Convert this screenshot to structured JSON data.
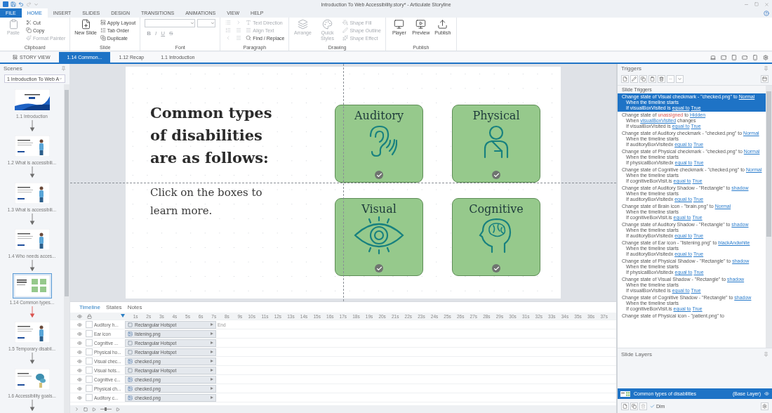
{
  "window": {
    "title": "Introduction To Web Accessibility.story* - Articulate Storyline"
  },
  "ribbon_tabs": [
    {
      "label": "FILE",
      "kind": "file",
      "selected": false
    },
    {
      "label": "HOME",
      "kind": "tab",
      "selected": true
    },
    {
      "label": "INSERT",
      "kind": "tab",
      "selected": false
    },
    {
      "label": "SLIDES",
      "kind": "tab",
      "selected": false
    },
    {
      "label": "DESIGN",
      "kind": "tab",
      "selected": false
    },
    {
      "label": "TRANSITIONS",
      "kind": "tab",
      "selected": false
    },
    {
      "label": "ANIMATIONS",
      "kind": "tab",
      "selected": false
    },
    {
      "label": "VIEW",
      "kind": "tab",
      "selected": false
    },
    {
      "label": "HELP",
      "kind": "tab",
      "selected": false
    }
  ],
  "ribbon_groups": [
    {
      "label": "Clipboard",
      "kind": "standard",
      "items": [
        {
          "label": "Paste",
          "kind": "large",
          "disabled": true
        },
        {
          "label": "Cut",
          "kind": "small",
          "disabled": false
        },
        {
          "label": "Copy",
          "kind": "small",
          "disabled": false
        },
        {
          "label": "Format Painter",
          "kind": "small",
          "disabled": true
        }
      ]
    },
    {
      "label": "Slide",
      "kind": "standard",
      "items": [
        {
          "label": "New Slide",
          "kind": "large",
          "disabled": false
        },
        {
          "label": "Apply Layout",
          "kind": "small",
          "disabled": false
        },
        {
          "label": "Tab Order",
          "kind": "small",
          "disabled": false
        },
        {
          "label": "Duplicate",
          "kind": "small",
          "disabled": false
        }
      ]
    },
    {
      "label": "Font",
      "kind": "font",
      "disabled": true,
      "format_buttons": [
        "B",
        "I",
        "U",
        "S"
      ]
    },
    {
      "label": "Paragraph",
      "kind": "standard",
      "items": [
        {
          "kind": "icon",
          "disabled": true
        },
        {
          "kind": "icon",
          "disabled": true
        },
        {
          "kind": "icon",
          "disabled": true
        },
        {
          "kind": "icon",
          "disabled": true
        },
        {
          "kind": "icon",
          "disabled": true
        },
        {
          "kind": "icon",
          "disabled": true
        },
        {
          "label": "Text Direction",
          "kind": "small",
          "disabled": true
        },
        {
          "label": "Align Text",
          "kind": "small",
          "disabled": true
        },
        {
          "label": "Find / Replace",
          "kind": "small",
          "disabled": false
        }
      ]
    },
    {
      "label": "Drawing",
      "kind": "standard",
      "items": [
        {
          "label": "Arrange",
          "kind": "large",
          "disabled": true
        },
        {
          "label": "Quick Styles",
          "kind": "large",
          "disabled": true
        },
        {
          "label": "Shape Fill",
          "kind": "small",
          "disabled": true
        },
        {
          "label": "Shape Outline",
          "kind": "small",
          "disabled": true
        },
        {
          "label": "Shape Effect",
          "kind": "small",
          "disabled": true
        }
      ]
    },
    {
      "label": "Publish",
      "kind": "standard",
      "items": [
        {
          "label": "Player",
          "kind": "large",
          "disabled": false
        },
        {
          "label": "Preview",
          "kind": "large",
          "disabled": false
        },
        {
          "label": "Publish",
          "kind": "large",
          "disabled": false
        }
      ]
    }
  ],
  "doc_tabs": [
    {
      "label": "STORY VIEW",
      "kind": "story",
      "selected": false
    },
    {
      "label": "1.14 Common...",
      "kind": "slide",
      "selected": true
    },
    {
      "label": "1.12 Recap",
      "kind": "slide",
      "selected": false
    },
    {
      "label": "1.1 Introduction",
      "kind": "slide",
      "selected": false
    }
  ],
  "scenes": {
    "title": "Scenes",
    "dropdown": "1 Introduction To Web A",
    "slides": [
      {
        "label": "1.1 Introduction",
        "kind": "waves",
        "selected": false,
        "color": "#6d6d6d"
      },
      {
        "label": "1.2 What is accessibili...",
        "kind": "figure",
        "selected": false,
        "color": "#6d6d6d"
      },
      {
        "label": "1.3 What is accessibili...",
        "kind": "figure",
        "selected": false,
        "color": "#6d6d6d"
      },
      {
        "label": "1.4 Who needs acces...",
        "kind": "figure",
        "selected": false,
        "color": "#6d6d6d"
      },
      {
        "label": "1.14 Common types...",
        "kind": "grid",
        "selected": true,
        "color": "#d9534f"
      },
      {
        "label": "1.5 Temporary disabil...",
        "kind": "figure",
        "selected": false,
        "color": "#6d6d6d"
      },
      {
        "label": "1.6 Accessibility goals...",
        "kind": "plant",
        "selected": false,
        "color": "#6d6d6d"
      }
    ]
  },
  "slide": {
    "heading": "Common types of disabilities are as follows:",
    "body": "Click on the boxes to learn more.",
    "cards": [
      {
        "title": "Auditory",
        "kind": "ear",
        "checked": true
      },
      {
        "title": "Physical",
        "kind": "person",
        "checked": true
      },
      {
        "title": "Visual",
        "kind": "eye",
        "checked": true
      },
      {
        "title": "Cognitive",
        "kind": "brain",
        "checked": true
      }
    ]
  },
  "timeline": {
    "tabs": [
      {
        "label": "Timeline",
        "selected": true
      },
      {
        "label": "States",
        "selected": false
      },
      {
        "label": "Notes",
        "selected": false
      }
    ],
    "ticks": [
      "1s",
      "2s",
      "3s",
      "4s",
      "5s",
      "6s",
      "7s",
      "8s",
      "9s",
      "10s",
      "11s",
      "12s",
      "13s",
      "14s",
      "15s",
      "16s",
      "17s",
      "18s",
      "19s",
      "20s",
      "21s",
      "22s",
      "23s",
      "24s",
      "25s",
      "26s",
      "27s",
      "28s",
      "29s",
      "30s",
      "31s",
      "32s",
      "33s",
      "34s",
      "35s",
      "36s",
      "37s"
    ],
    "end_label": "End",
    "rows": [
      {
        "name": "Auditory h...",
        "object": "Rectangular Hotspot",
        "kind": "hotspot",
        "visible": true,
        "locked": false
      },
      {
        "name": "Ear icon",
        "object": "listening.png",
        "kind": "image",
        "visible": true,
        "locked": false
      },
      {
        "name": "Cognitive ...",
        "object": "Rectangular Hotspot",
        "kind": "hotspot",
        "visible": true,
        "locked": false
      },
      {
        "name": "Physical ho...",
        "object": "Rectangular Hotspot",
        "kind": "hotspot",
        "visible": true,
        "locked": false
      },
      {
        "name": "Visual chec...",
        "object": "checked.png",
        "kind": "image",
        "visible": true,
        "locked": false
      },
      {
        "name": "Visual hots...",
        "object": "Rectangular Hotspot",
        "kind": "hotspot",
        "visible": true,
        "locked": false
      },
      {
        "name": "Cognitive c...",
        "object": "checked.png",
        "kind": "image",
        "visible": true,
        "locked": false
      },
      {
        "name": "Physical ch...",
        "object": "checked.png",
        "kind": "image",
        "visible": true,
        "locked": false
      },
      {
        "name": "Auditory c...",
        "object": "checked.png",
        "kind": "image",
        "visible": true,
        "locked": false
      }
    ],
    "zoom": {
      "level": 0.35
    }
  },
  "triggers": {
    "title": "Triggers",
    "section": "Slide Triggers",
    "items": [
      {
        "selected": true,
        "lines": [
          [
            {
              "text": "Change state of Visual checkmark - \"checked.png\" to",
              "kind": "text"
            },
            {
              "text": "Normal",
              "kind": "link"
            }
          ],
          [
            {
              "text": "When the timeline starts",
              "kind": "text"
            }
          ],
          [
            {
              "text": "If visualBoxVisited is",
              "kind": "text"
            },
            {
              "text": "equal to",
              "kind": "link"
            },
            {
              "text": "True",
              "kind": "link"
            }
          ]
        ]
      },
      {
        "selected": false,
        "lines": [
          [
            {
              "text": "Change state of",
              "kind": "text"
            },
            {
              "text": "unassigned",
              "kind": "error"
            },
            {
              "text": "to",
              "kind": "text"
            },
            {
              "text": "Hidden",
              "kind": "link"
            }
          ],
          [
            {
              "text": "When",
              "kind": "text"
            },
            {
              "text": "visualBoxVisited",
              "kind": "link"
            },
            {
              "text": "changes",
              "kind": "text"
            }
          ],
          [
            {
              "text": "If visualBoxVisited is",
              "kind": "text"
            },
            {
              "text": "equal to",
              "kind": "link"
            },
            {
              "text": "True",
              "kind": "link"
            }
          ]
        ]
      },
      {
        "selected": false,
        "lines": [
          [
            {
              "text": "Change state of Auditory checkmark - \"checked.png\" to",
              "kind": "text"
            },
            {
              "text": "Normal",
              "kind": "link"
            }
          ],
          [
            {
              "text": "When the timeline starts",
              "kind": "text"
            }
          ],
          [
            {
              "text": "If auditoryBoxVisitedx",
              "kind": "text"
            },
            {
              "text": "equal to",
              "kind": "link"
            },
            {
              "text": "True",
              "kind": "link"
            }
          ]
        ]
      },
      {
        "selected": false,
        "lines": [
          [
            {
              "text": "Change state of Physical checkmark - \"checked.png\" to",
              "kind": "text"
            },
            {
              "text": "Normal",
              "kind": "link"
            }
          ],
          [
            {
              "text": "When the timeline starts",
              "kind": "text"
            }
          ],
          [
            {
              "text": "If physicalBoxVisitedx",
              "kind": "text"
            },
            {
              "text": "equal to",
              "kind": "link"
            },
            {
              "text": "True",
              "kind": "link"
            }
          ]
        ]
      },
      {
        "selected": false,
        "lines": [
          [
            {
              "text": "Change state of Cognitive checkmark - \"checked.png\" to",
              "kind": "text"
            },
            {
              "text": "Normal",
              "kind": "link"
            }
          ],
          [
            {
              "text": "When the timeline starts",
              "kind": "text"
            }
          ],
          [
            {
              "text": "If cognitiveBoxVisit.is",
              "kind": "text"
            },
            {
              "text": "equal to",
              "kind": "link"
            },
            {
              "text": "True",
              "kind": "link"
            }
          ]
        ]
      },
      {
        "selected": false,
        "lines": [
          [
            {
              "text": "Change state of Auditory Shadow - \"Rectangle\" to",
              "kind": "text"
            },
            {
              "text": "shadow",
              "kind": "link"
            }
          ],
          [
            {
              "text": "When the timeline starts",
              "kind": "text"
            }
          ],
          [
            {
              "text": "If auditoryBoxVisitedx",
              "kind": "text"
            },
            {
              "text": "equal to",
              "kind": "link"
            },
            {
              "text": "True",
              "kind": "link"
            }
          ]
        ]
      },
      {
        "selected": false,
        "lines": [
          [
            {
              "text": "Change state of Brain icon - \"brain.png\" to",
              "kind": "text"
            },
            {
              "text": "Normal",
              "kind": "link"
            }
          ],
          [
            {
              "text": "When the timeline starts",
              "kind": "text"
            }
          ],
          [
            {
              "text": "If cognitiveBoxVisit.is",
              "kind": "text"
            },
            {
              "text": "equal to",
              "kind": "link"
            },
            {
              "text": "True",
              "kind": "link"
            }
          ]
        ]
      },
      {
        "selected": false,
        "lines": [
          [
            {
              "text": "Change state of Auditory Shadow - \"Rectangle\" to",
              "kind": "text"
            },
            {
              "text": "shadow",
              "kind": "link"
            }
          ],
          [
            {
              "text": "When the timeline starts",
              "kind": "text"
            }
          ],
          [
            {
              "text": "If auditoryBoxVisitedx",
              "kind": "text"
            },
            {
              "text": "equal to",
              "kind": "link"
            },
            {
              "text": "True",
              "kind": "link"
            }
          ]
        ]
      },
      {
        "selected": false,
        "lines": [
          [
            {
              "text": "Change state of Ear icon - \"listening.png\" to",
              "kind": "text"
            },
            {
              "text": "blackAndwhite",
              "kind": "link"
            }
          ],
          [
            {
              "text": "When the timeline starts",
              "kind": "text"
            }
          ],
          [
            {
              "text": "If auditoryBoxVisitedx",
              "kind": "text"
            },
            {
              "text": "equal to",
              "kind": "link"
            },
            {
              "text": "True",
              "kind": "link"
            }
          ]
        ]
      },
      {
        "selected": false,
        "lines": [
          [
            {
              "text": "Change state of Physical Shadow - \"Rectangle\" to",
              "kind": "text"
            },
            {
              "text": "shadow",
              "kind": "link"
            }
          ],
          [
            {
              "text": "When the timeline starts",
              "kind": "text"
            }
          ],
          [
            {
              "text": "If physicalBoxVisitedx",
              "kind": "text"
            },
            {
              "text": "equal to",
              "kind": "link"
            },
            {
              "text": "True",
              "kind": "link"
            }
          ]
        ]
      },
      {
        "selected": false,
        "lines": [
          [
            {
              "text": "Change state of Visual Shadow - \"Rectangle\" to",
              "kind": "text"
            },
            {
              "text": "shadow",
              "kind": "link"
            }
          ],
          [
            {
              "text": "When the timeline starts",
              "kind": "text"
            }
          ],
          [
            {
              "text": "If visualBoxVisited is",
              "kind": "text"
            },
            {
              "text": "equal to",
              "kind": "link"
            },
            {
              "text": "True",
              "kind": "link"
            }
          ]
        ]
      },
      {
        "selected": false,
        "lines": [
          [
            {
              "text": "Change state of Cognitive Shadow - \"Rectangle\" to",
              "kind": "text"
            },
            {
              "text": "shadow",
              "kind": "link"
            }
          ],
          [
            {
              "text": "When the timeline starts",
              "kind": "text"
            }
          ],
          [
            {
              "text": "If cognitiveBoxVisit.is",
              "kind": "text"
            },
            {
              "text": "equal to",
              "kind": "link"
            },
            {
              "text": "True",
              "kind": "link"
            }
          ]
        ]
      },
      {
        "selected": false,
        "lines": [
          [
            {
              "text": "Change state of Physical icon - \"patient.png\" to",
              "kind": "text"
            }
          ]
        ]
      }
    ]
  },
  "layers": {
    "title": "Slide Layers",
    "items": [
      {
        "name": "Common types of disabilities",
        "note": "(Base Layer)",
        "selected": true
      }
    ],
    "dim": {
      "label": "Dim",
      "checked": true
    }
  }
}
